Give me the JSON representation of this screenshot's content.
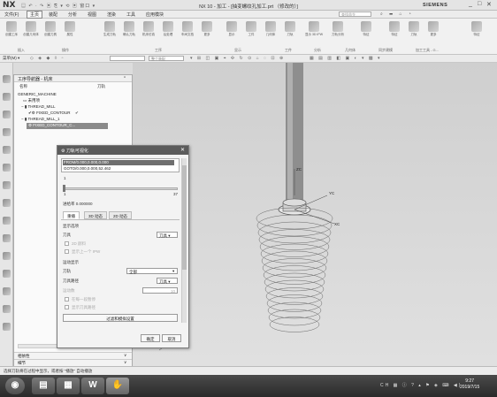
{
  "titlebar": {
    "logo": "NX",
    "quick_access": "▤ ↶ · ↷ ▣ ⎘ ▾ ⟲ ▣ 窗口 ▾",
    "title": "NX 10 - 加工 - [抽变螺纹孔加工.prt （修改的）]",
    "brand": "SIEMENS",
    "min": "_",
    "max": "□",
    "close": "✕"
  },
  "menubar": {
    "items": [
      "文件(F)",
      "主页",
      "装配",
      "分析",
      "视图",
      "渲染",
      "工具",
      "应用模块"
    ],
    "search_placeholder": "查找命令"
  },
  "ribbon": {
    "buttons": [
      "创建工序",
      "创建几何体",
      "创建刀具",
      "属性",
      "生成刀轨",
      "确认刀轨",
      "机床仿真",
      "后处理",
      "车间文档",
      "更多",
      "显示",
      "工件",
      "几何体",
      "刀轨",
      "显示 3D IPW",
      "刀轨分析",
      "特征",
      "特征",
      "刀轨",
      "更多",
      "特征"
    ],
    "groups": [
      "插入",
      "操作",
      "工序",
      "显示",
      "工件",
      "分析",
      "几何体",
      "同步建模",
      "加工工具 - G..."
    ]
  },
  "toolbar": {
    "menu_label": "菜单(M) ▾",
    "combo1": "",
    "combo2": "整个装配"
  },
  "navigator": {
    "title": "工序导航器 - 机床",
    "col_name": "名称",
    "col_tool": "刀轨",
    "rows": [
      {
        "label": "GENERIC_MACHINE",
        "check": ""
      },
      {
        "label": "未用项",
        "check": ""
      },
      {
        "label": "THREAD_MILL",
        "check": ""
      },
      {
        "label": "FIXED_CONTOUR",
        "check": "✔"
      },
      {
        "label": "THREAD_MILL_1",
        "check": ""
      },
      {
        "label": "FIXED_CONTOUR_C...",
        "check": ""
      }
    ],
    "bottom_1": "相依性",
    "bottom_2": "细节"
  },
  "dialog": {
    "title": "刀轨可视化",
    "lines": [
      "FROM/0.000,0.000,0.000",
      "GOTO/0.000,0.000,52.462"
    ],
    "slider_min": "1",
    "slider_min_left": "1",
    "slider_max": "37",
    "feed_label": "进给率 0.000000",
    "tabs": [
      "重播",
      "3D 动态",
      "2D 动态"
    ],
    "display_options": "显示选项",
    "tool_label": "刀具",
    "tool_value": "刀具 ▾",
    "check_2d": "2D 颜料",
    "check_prev_ipw": "显示上一个 IPW",
    "motion_display": "运动显示",
    "toolpath_label": "刀轨",
    "toolpath_value": "全部",
    "tool_select_label": "刀具路径",
    "tool_select_value": "刀具 ▾",
    "motion_count_label": "运动数",
    "motion_count_value": "10",
    "check_each": "在每一段暂停",
    "check_show_tool": "显示刀具路径",
    "filter_button": "过滤和模拟设置",
    "ok": "确定",
    "cancel": "取消"
  },
  "viewport": {
    "label_yc": "YC",
    "label_xc": "XC",
    "label_zc": "ZC"
  },
  "statusbar": {
    "text": "选择刀轨将在过程中显示，或者按 \"播放\" 自动播放"
  },
  "taskbar": {
    "time": "9:27",
    "date": "2019/7/15",
    "tray": "CH ▦ ⓘ ? ▴ ⚑ ◈ ⌨ ◀)"
  }
}
